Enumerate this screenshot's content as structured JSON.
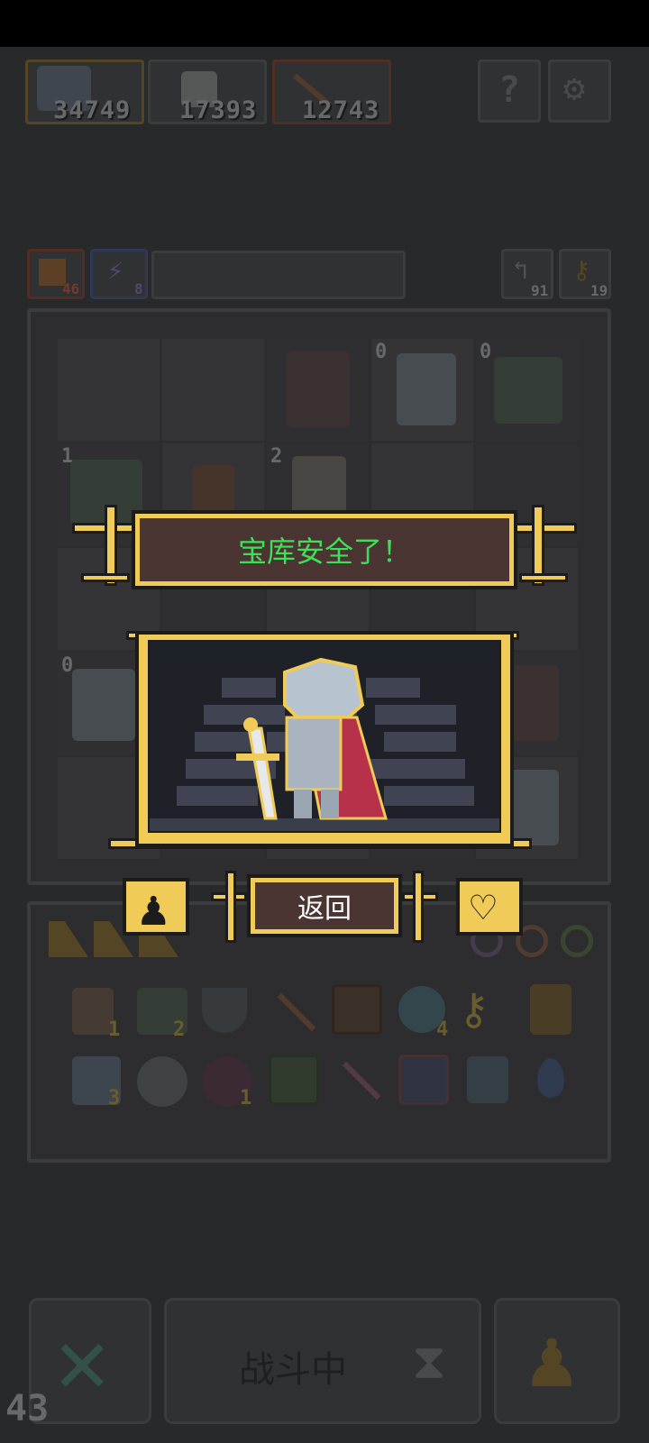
{
  "top_resources": [
    {
      "icon": "hero-portrait-icon",
      "value": "34749"
    },
    {
      "icon": "tombstone-icon",
      "value": "17393"
    },
    {
      "icon": "arrow-icon",
      "value": "12743"
    }
  ],
  "top_buttons": [
    {
      "icon": "help-icon"
    },
    {
      "icon": "settings-gear-icon"
    }
  ],
  "stat_chips": [
    {
      "icon": "sword-boost-icon",
      "value": "46"
    },
    {
      "icon": "lightning-icon",
      "value": "8"
    }
  ],
  "right_counters": [
    {
      "icon": "return-arrow-icon",
      "value": "91"
    },
    {
      "icon": "key-icon",
      "value": "19"
    }
  ],
  "dialog": {
    "title": "宝库安全了！",
    "back_label": "返回",
    "left_icon": "pawn-icon",
    "right_icon": "heart-gem-icon",
    "scene_icon": "armored-knight-icon"
  },
  "unit_badges": [
    "0",
    "0",
    "1",
    "2",
    "0"
  ],
  "inventory_badges": [
    "1",
    "2",
    "4",
    "3",
    "1"
  ],
  "bottom_bar": {
    "battle_label": "战斗中",
    "cancel_icon": "cross-icon",
    "hourglass_icon": "hourglass-icon",
    "pawn_icon": "pawn-icon"
  },
  "fps_counter": "43",
  "colors": {
    "background": "#2f3032",
    "gold": "#f1cb57",
    "dialog_panel": "#4a3532",
    "title_green": "#3ee05a"
  }
}
